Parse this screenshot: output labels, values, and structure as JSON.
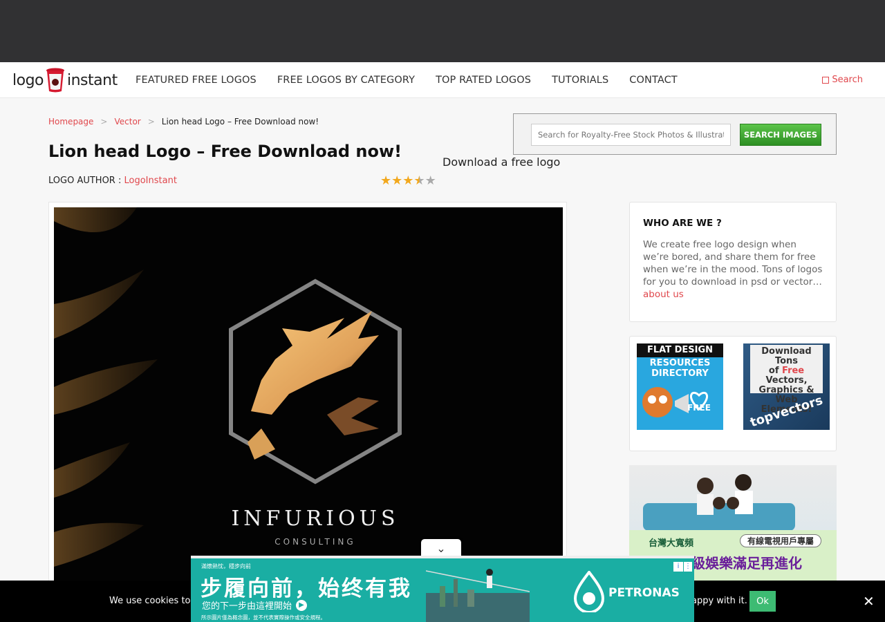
{
  "header": {
    "logo_text_left": "logo",
    "logo_text_right": "instant",
    "nav": [
      "FEATURED FREE LOGOS",
      "FREE LOGOS BY CATEGORY",
      "TOP RATED LOGOS",
      "TUTORIALS",
      "CONTACT"
    ],
    "search_label": "Search"
  },
  "breadcrumb": {
    "home": "Homepage",
    "category": "Vector",
    "current": "Lion head Logo – Free Download now!"
  },
  "page": {
    "title": "Lion head Logo – Free Download now!",
    "author_label": "LOGO AUTHOR :",
    "author_name": "LogoInstant",
    "rating": 3.5,
    "rating_max": 5,
    "download_text": "Download a free logo"
  },
  "stock_search": {
    "placeholder": "Search for Royalty-Free Stock Photos & Illustrations",
    "button": "SEARCH IMAGES"
  },
  "logo_image": {
    "brand": "INFURIOUS",
    "tagline": "CONSULTING"
  },
  "sidebar": {
    "who_title": "WHO ARE WE ?",
    "who_text": "We create free logo design when we’re bored, and share them for free when we’re in the mood. Tons of logos for you to download in psd or vector…",
    "about_link": "about us",
    "ad1_header": "FLAT DESIGN",
    "ad1_line1": "RESOURCES",
    "ad1_line2": "DIRECTORY",
    "ad1_free": "FREE",
    "ad2_line1": "Download Tons",
    "ad2_of": "of",
    "ad2_free": "Free",
    "ad2_line2": "Vectors,",
    "ad2_line3": "Graphics &",
    "ad2_line4": "Web Elements!",
    "ad2_brand": "topvectors",
    "ad3_brand": "台灣大寬頻",
    "ad3_badge": "有線電視用戶專屬",
    "ad3_text": "級娛樂滿足再進化"
  },
  "cookie": {
    "text_left": "We use cookies to e",
    "text_right": "appy with it.",
    "ok": "Ok",
    "close": "✕"
  },
  "bottom_ad": {
    "small": "滿懷熱忱，穩步向前",
    "headline": "步履向前，始终有我",
    "sub": "您的下一步由這裡開始",
    "tiny": "所示圖片僅為概念圖，並不代表實際操作或安全規程。",
    "brand": "PETRONAS",
    "info": "i",
    "close": "⋮"
  },
  "colors": {
    "accent": "#e0474c",
    "topbar": "#313133",
    "star": "#f2a81d",
    "ok_green": "#3dbb73"
  }
}
